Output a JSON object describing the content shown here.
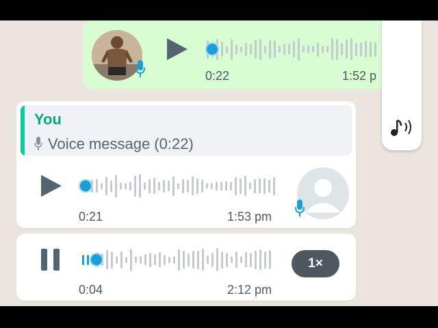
{
  "colors": {
    "outgoing_bubble": "#d9fdd3",
    "incoming_bubble": "#ffffff",
    "progress_dot": "#1a9ed8",
    "quote_accent": "#06cf9c",
    "chat_background": "#ece5dd"
  },
  "messages": [
    {
      "direction": "outgoing",
      "sender_avatar": "contact-photo",
      "status_icon": "play-icon",
      "duration": "0:22",
      "time": "1:52 p",
      "progress": 0
    },
    {
      "direction": "incoming",
      "quote": {
        "author": "You",
        "icon": "mic-icon",
        "text": "Voice message (0:22)"
      },
      "sender_avatar": "default-avatar",
      "status_icon": "play-icon",
      "duration": "0:21",
      "time": "1:53 pm",
      "progress": 0
    },
    {
      "direction": "incoming",
      "status_icon": "pause-icon",
      "duration": "0:04",
      "time": "2:12 pm",
      "progress": 0.05,
      "speed": "1×"
    }
  ],
  "side_panel": {
    "icon": "speaker-music-icon"
  }
}
